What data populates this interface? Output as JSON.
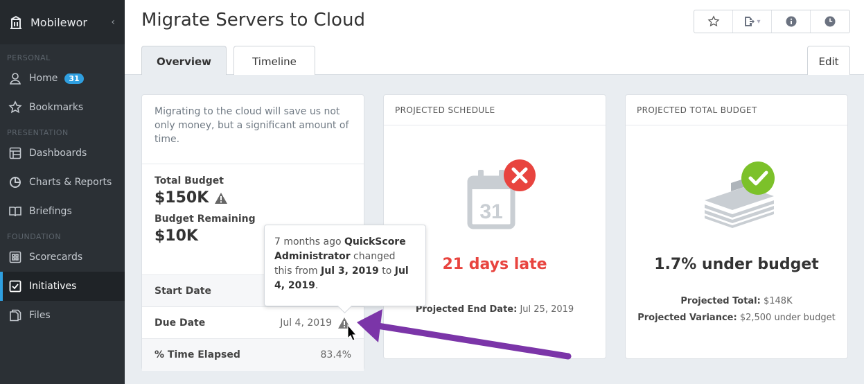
{
  "sidebar": {
    "brand": "Mobilewor",
    "collapse_glyph": "‹",
    "sections": {
      "personal": "PERSONAL",
      "presentation": "PRESENTATION",
      "foundation": "FOUNDATION"
    },
    "items": [
      {
        "label": "Home",
        "icon": "user-icon",
        "badge": "31"
      },
      {
        "label": "Bookmarks",
        "icon": "star-icon"
      },
      {
        "label": "Dashboards",
        "icon": "dashboard-icon"
      },
      {
        "label": "Charts & Reports",
        "icon": "pie-chart-icon"
      },
      {
        "label": "Briefings",
        "icon": "book-icon"
      },
      {
        "label": "Scorecards",
        "icon": "scorecard-icon"
      },
      {
        "label": "Initiatives",
        "icon": "checkbox-icon",
        "active": true
      },
      {
        "label": "Files",
        "icon": "files-icon"
      }
    ]
  },
  "header": {
    "title": "Migrate Servers to Cloud",
    "tabs": [
      {
        "label": "Overview",
        "active": true
      },
      {
        "label": "Timeline"
      }
    ],
    "edit_label": "Edit",
    "toolbar_glyphs": {
      "star": "☆",
      "export": "▾",
      "info": "i",
      "clock": "◷"
    }
  },
  "summary": {
    "description": "Migrating to the cloud will save us not only money, but a significant amount of time.",
    "total_budget_label": "Total Budget",
    "total_budget_value": "$150K",
    "budget_remaining_label": "Budget Remaining",
    "budget_remaining_value": "$10K",
    "start_date_label": "Start Date",
    "due_date_label": "Due Date",
    "due_date_value": "Jul 4, 2019",
    "time_elapsed_label": "% Time Elapsed",
    "time_elapsed_value": "83.4%"
  },
  "tooltip": {
    "ago": "7 months ago ",
    "user": "QuickScore Administrator",
    "changed": " changed this from ",
    "from": "Jul 3, 2019",
    "to_word": " to ",
    "to": "Jul 4, 2019",
    "period": "."
  },
  "schedule": {
    "heading": "PROJECTED SCHEDULE",
    "calendar_day": "31",
    "status": "21 days late",
    "end_date_label": "Projected End Date:",
    "end_date_value": "Jul 25, 2019"
  },
  "budget": {
    "heading": "PROJECTED TOTAL BUDGET",
    "status": "1.7% under budget",
    "total_label": "Projected Total:",
    "total_value": "$148K",
    "variance_label": "Projected Variance:",
    "variance_value": "$2,500 under budget"
  },
  "colors": {
    "sidebar_bg": "#2b3035",
    "accent": "#2f9fe0",
    "late_red": "#e8443f",
    "ok_green": "#7cc12a",
    "arrow_purple": "#7b35a8"
  }
}
